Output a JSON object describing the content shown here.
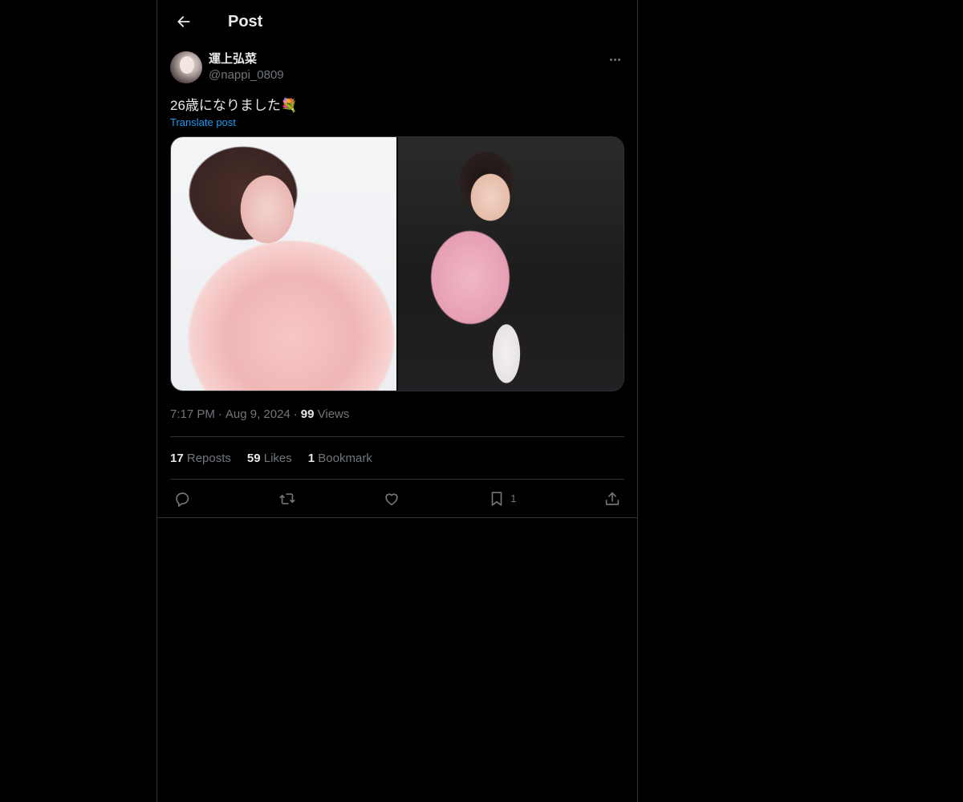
{
  "header": {
    "title": "Post",
    "back_icon": "arrow-left-icon"
  },
  "post": {
    "author": {
      "display_name": "運上弘菜",
      "handle": "@nappi_0809"
    },
    "text": "26歳になりました💐",
    "translate_label": "Translate post",
    "media": [
      {
        "description_icon": "photo-icon"
      },
      {
        "description_icon": "photo-icon"
      }
    ],
    "time": "7:17 PM",
    "date": "Aug 9, 2024",
    "views_count": "99",
    "views_label": "Views",
    "stats": {
      "reposts_count": "17",
      "reposts_label": "Reposts",
      "likes_count": "59",
      "likes_label": "Likes",
      "bookmarks_count": "1",
      "bookmarks_label": "Bookmark"
    },
    "actions": {
      "reply_icon": "reply-icon",
      "repost_icon": "repost-icon",
      "like_icon": "heart-icon",
      "bookmark_icon": "bookmark-icon",
      "bookmark_count": "1",
      "share_icon": "share-icon"
    }
  },
  "colors": {
    "background": "#000000",
    "text_primary": "#e7e9ea",
    "text_secondary": "#71767b",
    "accent": "#1d9bf0",
    "border": "#2f3336"
  }
}
